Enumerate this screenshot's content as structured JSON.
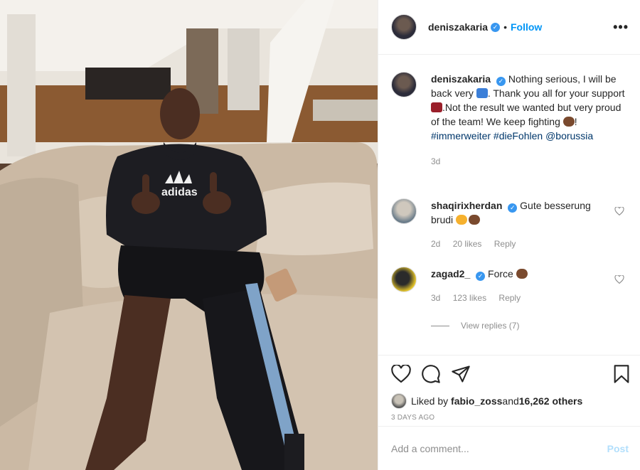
{
  "author": {
    "username": "deniszakaria",
    "follow_label": "Follow",
    "dot": "•",
    "more_label": "•••"
  },
  "caption": {
    "username": "deniszakaria",
    "text_1": "Nothing serious, I will be back very ",
    "text_2": ". Thank you all for your support ",
    "text_3": ".Not the result we wanted but very proud of the team! We keep fighting ",
    "text_4": "! ",
    "hashtag_1": "#immerweiter",
    "hashtag_2": "#dieFohlen",
    "mention": "@borussia",
    "time": "3d"
  },
  "comments": [
    {
      "username": "shaqirixherdan",
      "text": "Gute besserung brudi ",
      "time": "2d",
      "likes": "20 likes",
      "reply": "Reply"
    },
    {
      "username": "zagad2_",
      "text": "Force ",
      "time": "3d",
      "likes": "123 likes",
      "reply": "Reply"
    }
  ],
  "view_replies": "View replies (7)",
  "likes_line": {
    "prefix": "Liked by ",
    "user": "fabio_zoss",
    "and": " and ",
    "count": "16,262 others"
  },
  "date_label": "3 DAYS AGO",
  "add_comment": {
    "placeholder": "Add a comment...",
    "post_label": "Post"
  },
  "icons": [
    "heart-icon",
    "comment-icon",
    "share-icon",
    "bookmark-icon",
    "verified-badge-icon"
  ],
  "colors": {
    "link": "#00376b",
    "follow": "#0095f6",
    "verified": "#3897f0",
    "post_disabled": "#b2dffc"
  }
}
